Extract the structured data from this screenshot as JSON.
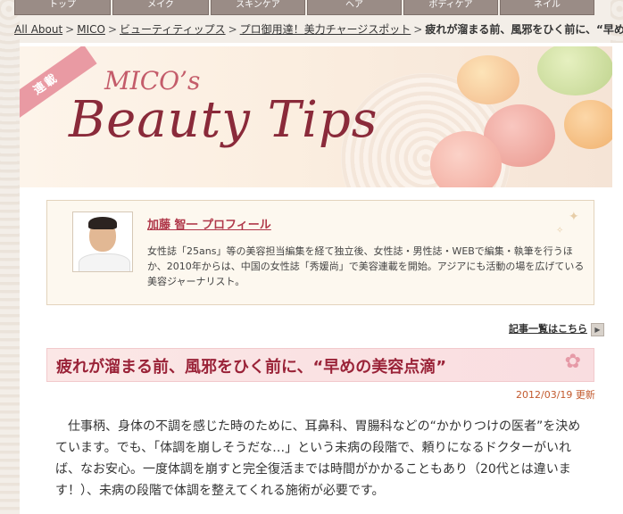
{
  "topnav": {
    "tabs": [
      "トップ",
      "メイク",
      "スキンケア",
      "ヘア",
      "ボディケア",
      "ネイル"
    ]
  },
  "breadcrumb": {
    "items": [
      "All About",
      "MICO",
      "ビューティティップス",
      "プロ御用達！美力チャージスポット"
    ],
    "separator": ">",
    "current": "疲れが溜まる前、風邪をひく前に、“早めの美容点"
  },
  "banner": {
    "ribbon": "連載",
    "title_small": "MICO’s",
    "title_big": "Beauty Tips"
  },
  "profile": {
    "name": "加藤 智一 プロフィール",
    "bio": "女性誌「25ans」等の美容担当編集を経て独立後、女性誌・男性誌・WEBで編集・執筆を行うほか、2010年からは、中国の女性誌「秀媛尚」で美容連載を開始。アジアにも活動の場を広げている美容ジャーナリスト。"
  },
  "list_link": {
    "label": "記事一覧はこちら"
  },
  "article": {
    "title": "疲れが溜まる前、風邪をひく前に、“早めの美容点滴”",
    "date": "2012/03/19 更新",
    "body": "仕事柄、身体の不調を感じた時のために、耳鼻科、胃腸科などの“かかりつけの医者”を決めています。でも、「体調を崩しそうだな…」という未病の段階で、頼りになるドクターがいれば、なお安心。一度体調を崩すと完全復活までは時間がかかることもあり（20代とは違います！）、未病の段階で体調を整えてくれる施術が必要です。"
  },
  "colors": {
    "accent": "#9a2338",
    "link": "#b0384a",
    "date": "#c25a2e",
    "tab": "#9a8c86"
  }
}
